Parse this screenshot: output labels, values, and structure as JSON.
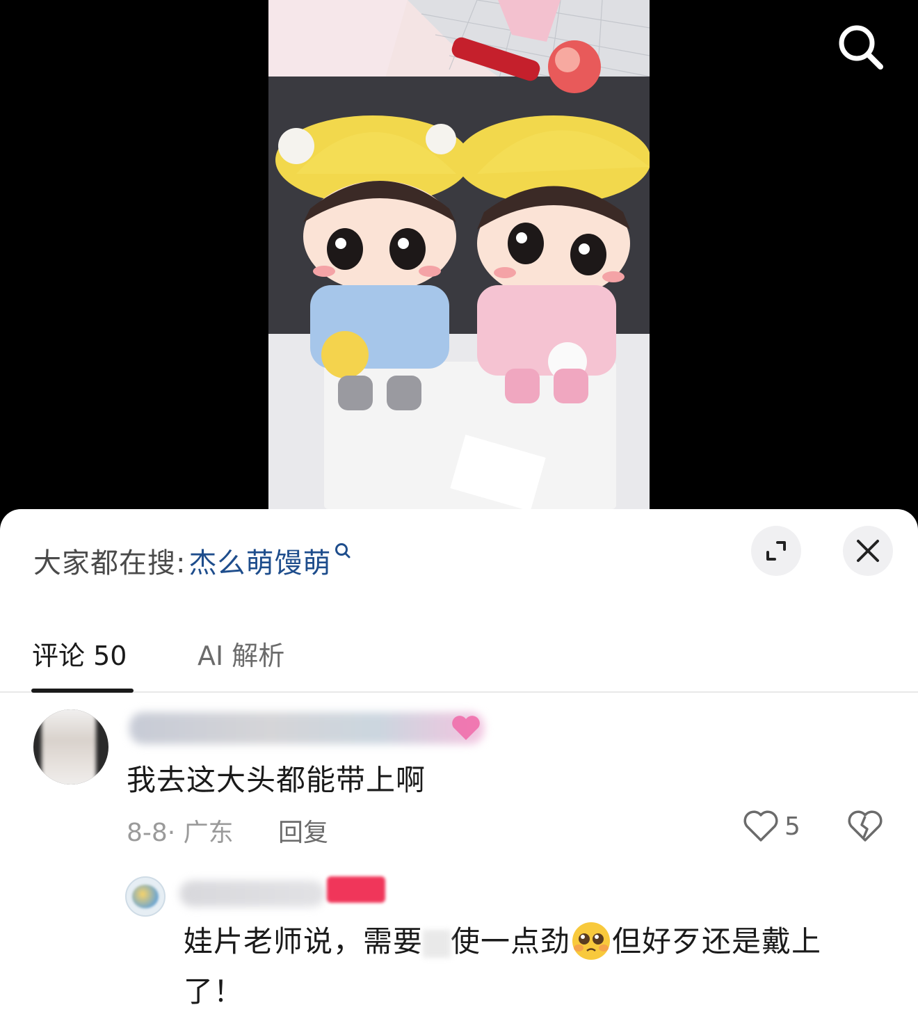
{
  "media": {
    "search_icon": "search-icon"
  },
  "sheet": {
    "trending_prefix": "大家都在搜:",
    "trending_term": "杰么萌馒萌",
    "trending_icon": "search-icon",
    "expand_icon": "expand-icon",
    "close_icon": "close-icon"
  },
  "tabs": [
    {
      "label": "评论 50",
      "active": true
    },
    {
      "label": "AI 解析",
      "active": false
    }
  ],
  "comment": {
    "text": "我去这大头都能带上啊",
    "date_location": "8-8· 广东",
    "reply_label": "回复",
    "likes": "5",
    "like_icon": "heart-outline-icon",
    "dislike_icon": "broken-heart-icon"
  },
  "reply": {
    "text_part1": "娃片老师说，需要",
    "text_part2": "使一点劲",
    "text_part3": "但好歹还是戴上了！",
    "emoji": "pleading-face-emoji"
  },
  "colors": {
    "accent_link": "#1e4d8c",
    "badge": "#f0365a"
  }
}
